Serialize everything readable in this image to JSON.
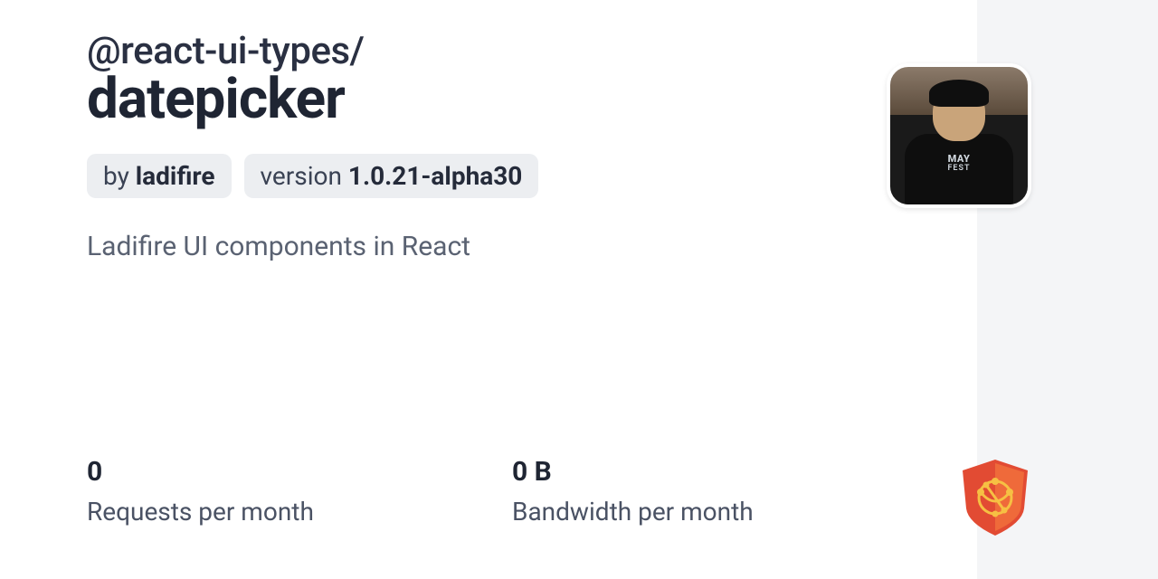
{
  "package": {
    "scope": "@react-ui-types/",
    "name": "datepicker",
    "description": "Ladifire UI components in React"
  },
  "badges": {
    "author_label": "by ",
    "author_value": "ladifire",
    "version_label": "version ",
    "version_value": "1.0.21-alpha30"
  },
  "stats": {
    "requests_value": "0",
    "requests_label": "Requests per month",
    "bandwidth_value": "0 B",
    "bandwidth_label": "Bandwidth per month"
  }
}
